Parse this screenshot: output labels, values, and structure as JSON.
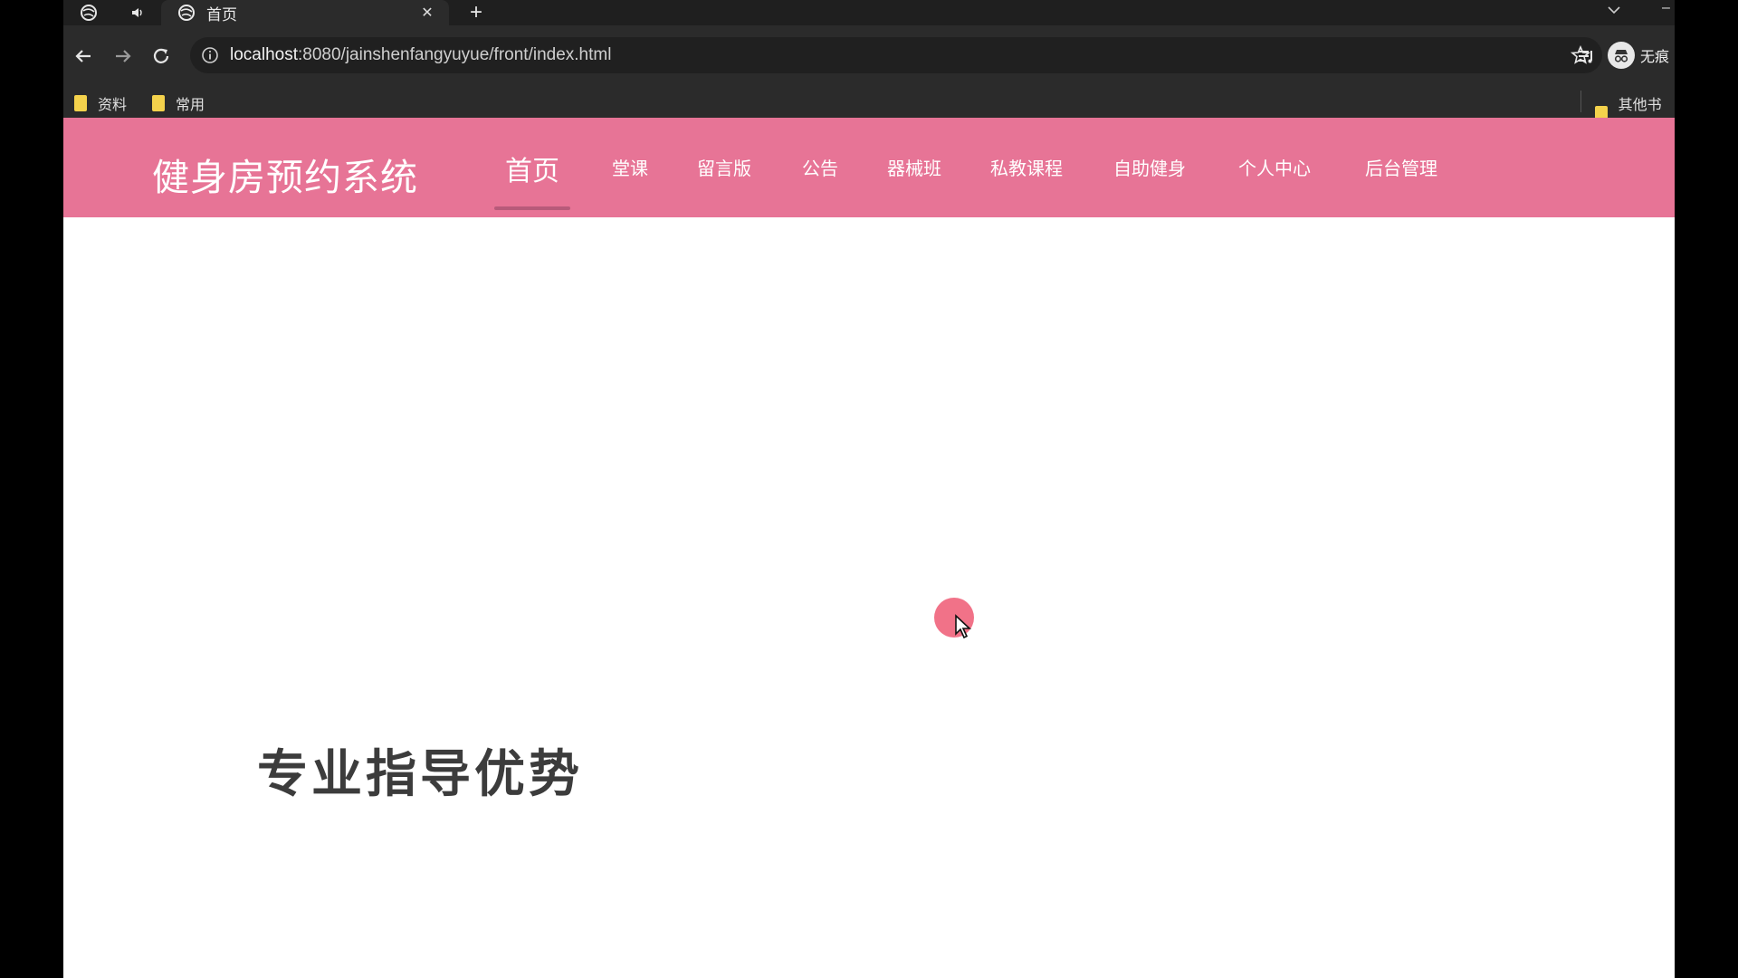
{
  "browser": {
    "tab_title": "首页",
    "tab_close": "✕",
    "new_tab": "+",
    "url_host": "localhost",
    "url_rest": ":8080/jainshenfangyuyue/front/index.html",
    "profile_name": "无痕",
    "bookmarks": [
      {
        "label": "资料"
      },
      {
        "label": "常用"
      }
    ],
    "other_bookmarks": "其他书签"
  },
  "site": {
    "title": "健身房预约系统",
    "nav": [
      {
        "label": "首页",
        "active": true
      },
      {
        "label": "堂课"
      },
      {
        "label": "留言版"
      },
      {
        "label": "公告"
      },
      {
        "label": "器械班"
      },
      {
        "label": "私教课程"
      },
      {
        "label": "自助健身"
      },
      {
        "label": "个人中心"
      },
      {
        "label": "后台管理"
      }
    ],
    "hero_heading": "专业指导优势"
  },
  "colors": {
    "header_bg": "#e77496",
    "active_underline": "#b85a7a",
    "chrome_bg": "#2b2b2b"
  }
}
